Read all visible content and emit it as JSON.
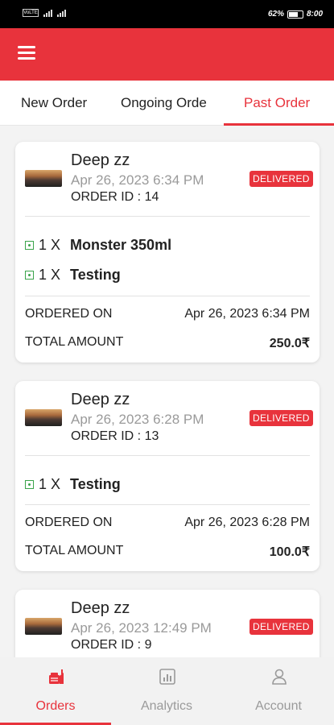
{
  "status_bar": {
    "carrier": "VoLTE",
    "battery": "62%",
    "time": "8:00"
  },
  "tabs": [
    {
      "label": "New Order"
    },
    {
      "label": "Ongoing Orde"
    },
    {
      "label": "Past Order"
    }
  ],
  "orders": [
    {
      "customer": "Deep zz",
      "datetime": "Apr 26, 2023 6:34 PM",
      "order_id": "ORDER ID : 14",
      "status": "DELIVERED",
      "items": [
        {
          "qty": "1 X",
          "name": "Monster 350ml"
        },
        {
          "qty": "1 X",
          "name": "Testing"
        }
      ],
      "ordered_on_label": "ORDERED ON",
      "ordered_on": "Apr 26, 2023 6:34 PM",
      "total_label": "TOTAL AMOUNT",
      "total": "250.0₹"
    },
    {
      "customer": "Deep zz",
      "datetime": "Apr 26, 2023 6:28 PM",
      "order_id": "ORDER ID : 13",
      "status": "DELIVERED",
      "items": [
        {
          "qty": "1 X",
          "name": "Testing"
        }
      ],
      "ordered_on_label": "ORDERED ON",
      "ordered_on": "Apr 26, 2023 6:28 PM",
      "total_label": "TOTAL AMOUNT",
      "total": "100.0₹"
    },
    {
      "customer": "Deep zz",
      "datetime": "Apr 26, 2023 12:49 PM",
      "order_id": "ORDER ID : 9",
      "status": "DELIVERED"
    }
  ],
  "bottom_nav": [
    {
      "label": "Orders",
      "icon": "orders-icon"
    },
    {
      "label": "Analytics",
      "icon": "analytics-icon"
    },
    {
      "label": "Account",
      "icon": "account-icon"
    }
  ],
  "colors": {
    "accent": "#e8333c",
    "veg": "#3aa34a",
    "muted": "#9a9a9a"
  }
}
